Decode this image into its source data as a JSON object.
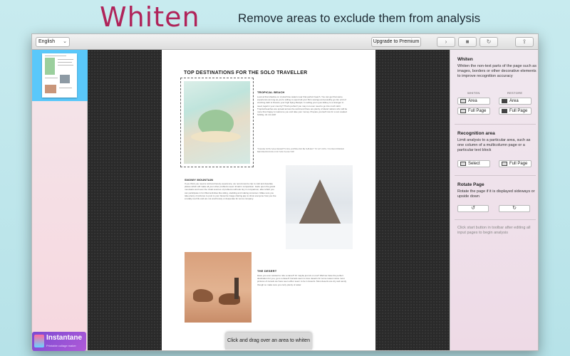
{
  "banner": {
    "title": "Whiten",
    "subtitle": "Remove areas to exclude them from analysis"
  },
  "toolbar": {
    "language": "English",
    "upgrade_label": "Upgrade to Premium",
    "icons": [
      "play-icon",
      "stop-icon",
      "refresh-icon",
      "share-icon"
    ]
  },
  "sidebar": {
    "add_label": "+",
    "eye_label": "◉"
  },
  "document": {
    "title": "TOP DESTINATIONS FOR THE SOLO TRAVELLER",
    "sections": [
      {
        "heading": "TROPICAL BEACH",
        "text": "Look at that shadow on crystal blue waters near that perfect beach. You can get that same experience as long as you're willing to spend all your life's savings and possibly go into a bit of crushing debt to finance your high flying lifestyle. Is selling your eyes kidney to a stranger in need, legal in your country? That's perfect! you may not even need to go into much debt. Tropical beaches are spread across the world and there are plenty of island nations who will be more than happy to welcome you and take your money. Prepare yourself now for a sun soaked holiday, do not wait!",
        "note": "*PLEASE NOTE SALE RECEIPTS WILL EXPIRE AND BE SUBJECT TO VAT UNTIL YOU RECONSIDER BEFORE BOOKING FOR THIS PLACE TRIP"
      },
      {
        "heading": "SNOWY MOUNTAIN",
        "text": "If you think you need a cold and lonely experience, we recommend a trip to cold and desolate places which will make all your other problems seem trivial in comparison. Gaze upon the grand mountains and soon the trivial sources of problems will look tiny in comparison, after which you can participate in fun filled activities like skiing, sledding and making snowmen. Make sure you take plenty of pictures to post to your favourite image sharing app to show everyone how you live a totally cool life and are not at all lonely or desperate for some company."
      },
      {
        "heading": "THE DESERT",
        "text": "Have you ever wanted to ride a camel? Or maybe just sit on one? Well we have the perfect destination for you, go to a desert! Camels seem to love deserts for some reason since most pictures of camels we have seen either seem to be in deserts. Most deserts are dry and sandy though so make sure you carry plenty of water."
      }
    ]
  },
  "toast": "Click and drag over an area to whiten",
  "panel": {
    "whiten": {
      "title": "Whiten",
      "description": "Whiten the non-text parts of the page such as images, borders or other decorative elements to improve recognition accuracy",
      "col_whiten": "WHITEN",
      "col_restore": "RESTORE",
      "area_label": "Area",
      "restore_area_label": "Area",
      "full_page_label": "Full Page",
      "restore_full_page_label": "Full Page"
    },
    "recognition": {
      "title": "Recognition area",
      "description": "Limit analysis to a particular area, such as one column of a multicolumn page or a particular text block",
      "select_label": "Select",
      "full_page_label": "Full Page"
    },
    "rotate": {
      "title": "Rotate Page",
      "description": "Rotate the page if it is displayed sideways or upside down",
      "left_label": "↺",
      "right_label": "↻"
    },
    "hint": "Click start button in toolbar after editing all input pages to begin analysis"
  },
  "badge": {
    "name": "Instantane",
    "tagline": "Printable collage maker"
  }
}
